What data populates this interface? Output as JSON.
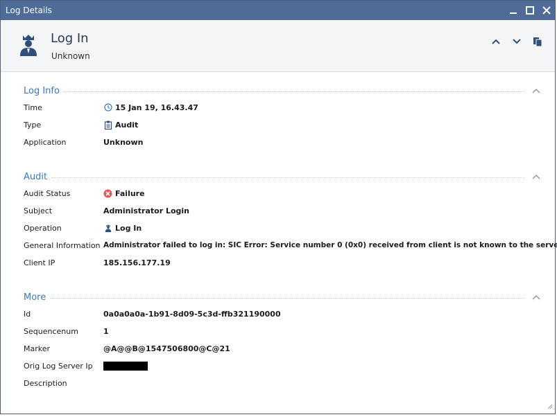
{
  "window": {
    "title": "Log Details"
  },
  "header": {
    "title": "Log In",
    "subtitle": "Unknown"
  },
  "sections": {
    "log_info": {
      "title": "Log Info",
      "rows": [
        {
          "label": "Time",
          "value": "15 Jan 19, 16.43.47",
          "icon": "clock-icon"
        },
        {
          "label": "Type",
          "value": "Audit",
          "icon": "clipboard-icon"
        },
        {
          "label": "Application",
          "value": "Unknown"
        }
      ]
    },
    "audit": {
      "title": "Audit",
      "rows": [
        {
          "label": "Audit Status",
          "value": "Failure",
          "icon": "error-icon"
        },
        {
          "label": "Subject",
          "value": "Administrator Login"
        },
        {
          "label": "Operation",
          "value": "Log In",
          "icon": "user-icon"
        },
        {
          "label": "General Information",
          "value": "Administrator failed to log in: SIC Error: Service number 0 (0x0) received from client is not known to the server"
        },
        {
          "label": "Client IP",
          "value": "185.156.177.19"
        }
      ]
    },
    "more": {
      "title": "More",
      "rows": [
        {
          "label": "Id",
          "value": "0a0a0a0a-1b91-8d09-5c3d-ffb321190000"
        },
        {
          "label": "Sequencenum",
          "value": "1"
        },
        {
          "label": "Marker",
          "value": "@A@@B@1547506800@C@21"
        },
        {
          "label": "Orig Log Server Ip",
          "value": ""
        },
        {
          "label": "Description",
          "value": ""
        }
      ]
    }
  },
  "colors": {
    "titlebar": "#4e6c97",
    "section_title": "#3a78c2",
    "error": "#e05a5a",
    "icon_navy": "#2f4f7a"
  }
}
